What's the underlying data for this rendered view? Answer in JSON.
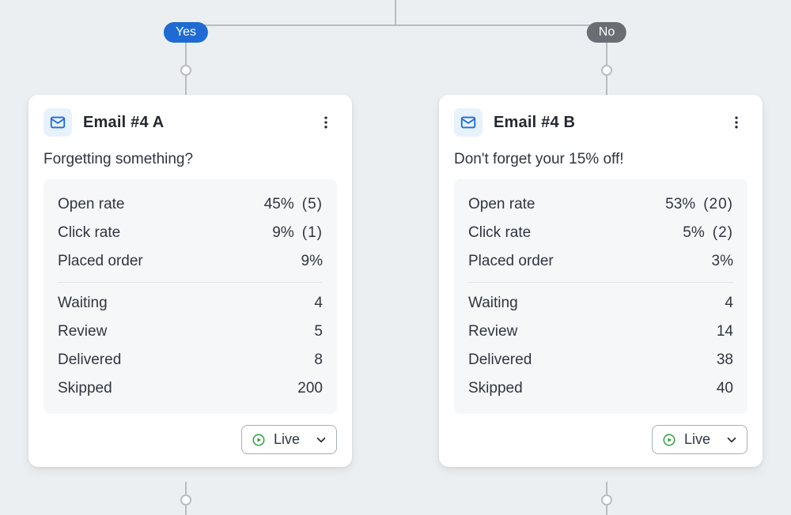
{
  "branch": {
    "yes_label": "Yes",
    "no_label": "No"
  },
  "labels": {
    "open_rate": "Open rate",
    "click_rate": "Click rate",
    "placed_order": "Placed order",
    "waiting": "Waiting",
    "review": "Review",
    "delivered": "Delivered",
    "skipped": "Skipped",
    "status_live": "Live"
  },
  "cards": [
    {
      "title": "Email #4 A",
      "subject": "Forgetting something?",
      "open_rate_pct": "45%",
      "open_rate_count": "(5)",
      "click_rate_pct": "9%",
      "click_rate_count": "(1)",
      "placed_order_pct": "9%",
      "waiting": "4",
      "review": "5",
      "delivered": "8",
      "skipped": "200",
      "status": "Live"
    },
    {
      "title": "Email #4 B",
      "subject": "Don't forget your 15% off!",
      "open_rate_pct": "53%",
      "open_rate_count": "(20)",
      "click_rate_pct": "5%",
      "click_rate_count": "(2)",
      "placed_order_pct": "3%",
      "waiting": "4",
      "review": "14",
      "delivered": "38",
      "skipped": "40",
      "status": "Live"
    }
  ]
}
